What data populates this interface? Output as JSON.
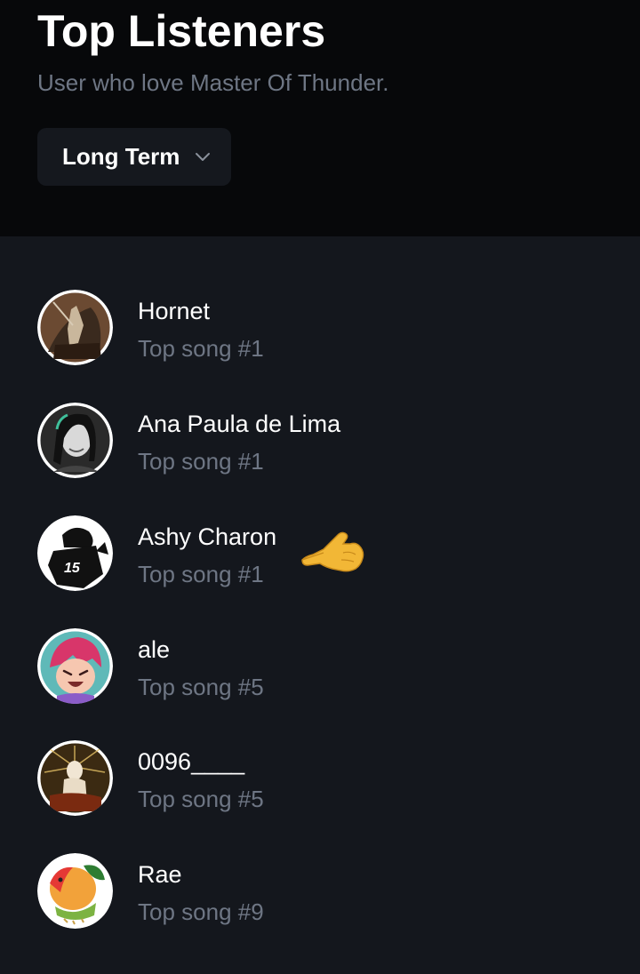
{
  "header": {
    "title": "Top Listeners",
    "subtitle": "User who love Master Of Thunder.",
    "filter": {
      "selected": "Long Term",
      "icon": "chevron-down-icon"
    }
  },
  "listeners": [
    {
      "name": "Hornet",
      "detail": "Top song #1",
      "avatar": "avatar-hornet"
    },
    {
      "name": "Ana Paula de Lima",
      "detail": "Top song #1",
      "avatar": "avatar-ana-paula"
    },
    {
      "name": "Ashy Charon",
      "detail": "Top song #1",
      "avatar": "avatar-ashy-charon"
    },
    {
      "name": "ale",
      "detail": "Top song #5",
      "avatar": "avatar-ale"
    },
    {
      "name": "0096____",
      "detail": "Top song #5",
      "avatar": "avatar-0096"
    },
    {
      "name": "Rae",
      "detail": "Top song #9",
      "avatar": "avatar-rae"
    }
  ],
  "pointer": {
    "icon": "pointing-hand-icon"
  },
  "colors": {
    "header_bg": "#07080a",
    "list_bg": "#14171d",
    "dropdown_bg": "#15181e",
    "muted_text": "#6e7684",
    "text": "#ffffff"
  }
}
